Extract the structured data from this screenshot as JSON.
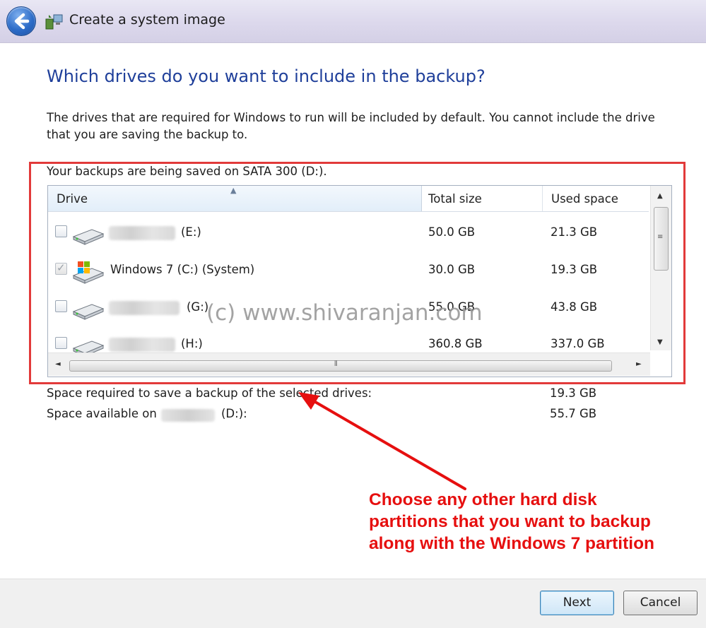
{
  "window": {
    "title": "Create a system image"
  },
  "page": {
    "heading": "Which drives do you want to include in the backup?",
    "description": "The drives that are required for Windows to run will be included by default. You cannot include the drive that you are saving the backup to.",
    "saved_on": "Your backups are being saved on SATA 300 (D:)."
  },
  "table": {
    "columns": [
      "Drive",
      "Total size",
      "Used space"
    ],
    "rows": [
      {
        "checked": false,
        "disabled": false,
        "label": "(E:)",
        "name_redacted": true,
        "icon": "hard-drive-icon",
        "total": "50.0 GB",
        "used": "21.3 GB"
      },
      {
        "checked": true,
        "disabled": true,
        "label": "Windows 7 (C:) (System)",
        "name_redacted": false,
        "icon": "windows-drive-icon",
        "total": "30.0 GB",
        "used": "19.3 GB"
      },
      {
        "checked": false,
        "disabled": false,
        "label": "(G:)",
        "name_redacted": true,
        "icon": "hard-drive-icon",
        "total": "55.0 GB",
        "used": "43.8 GB"
      },
      {
        "checked": false,
        "disabled": false,
        "label": "(H:)",
        "name_redacted": true,
        "icon": "hard-drive-icon",
        "total": "360.8 GB",
        "used": "337.0 GB"
      }
    ]
  },
  "space": {
    "required_label": "Space required to save a backup of the selected drives:",
    "required_value": "19.3 GB",
    "available_prefix": "Space available on",
    "available_suffix": "(D:):",
    "available_value": "55.7 GB"
  },
  "watermark": "(c) www.shivaranjan.com",
  "annotation": {
    "lines": [
      "Choose any other hard disk",
      "partitions that you want to backup",
      "along with the Windows 7 partition"
    ]
  },
  "buttons": {
    "next": "Next",
    "cancel": "Cancel"
  },
  "colors": {
    "heading": "#1f3f9a",
    "highlight": "#e23a3a",
    "annotation": "#e60f0f"
  }
}
